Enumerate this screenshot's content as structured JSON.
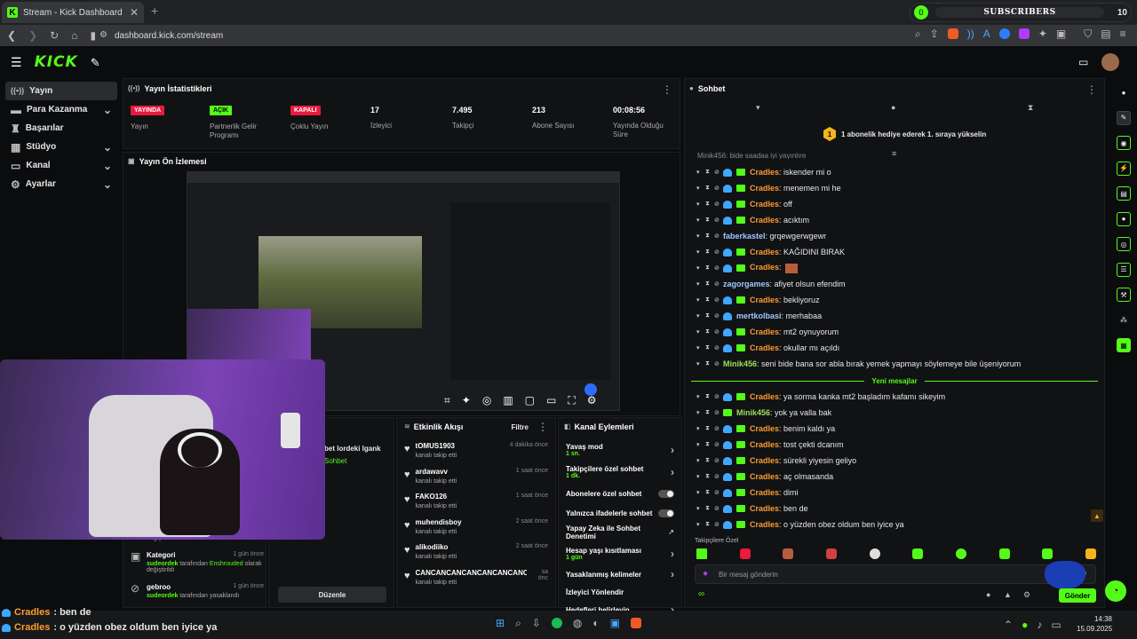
{
  "browser": {
    "tab_title": "Stream - Kick Dashboard",
    "url": "dashboard.kick.com/stream",
    "new_tab": "+"
  },
  "subs_widget": {
    "current": "0",
    "label": "SUBSCRIBERS",
    "goal": "10"
  },
  "header": {
    "logo": "KICK"
  },
  "sidebar": {
    "items": [
      {
        "label": "Yayın",
        "icon": "broadcast-icon",
        "chevron": false
      },
      {
        "label": "Para Kazanma",
        "icon": "money-icon",
        "chevron": true
      },
      {
        "label": "Başarılar",
        "icon": "trophy-icon",
        "chevron": false
      },
      {
        "label": "Stüdyo",
        "icon": "studio-icon",
        "chevron": true
      },
      {
        "label": "Kanal",
        "icon": "channel-icon",
        "chevron": true
      },
      {
        "label": "Ayarlar",
        "icon": "gear-icon",
        "chevron": true
      }
    ]
  },
  "stats": {
    "title": "Yayın İstatistikleri",
    "items": [
      {
        "badge": "YAYINDA",
        "label": "Yayın",
        "color": "#e91a3d"
      },
      {
        "badge": "AÇIK",
        "label": "Partnerlik Gelir Programı",
        "color": "#53fc18"
      },
      {
        "badge": "KAPALI",
        "label": "Çoklu Yayın",
        "color": "#e91a3d"
      },
      {
        "value": "17",
        "label": "İzleyici"
      },
      {
        "value": "7.495",
        "label": "Takipçi"
      },
      {
        "value": "213",
        "label": "Abone Sayısı"
      },
      {
        "value": "00:08:56",
        "label": "Yayında Olduğu Süre"
      }
    ]
  },
  "preview": {
    "title": "Yayın Ön İzlemesi"
  },
  "log": {
    "items": [
      {
        "title": "Kategori",
        "time": "1 gün önce",
        "user": "sudeordek",
        "text": "tarafından",
        "extra": "Enshrouded",
        "tail": "olarak değiştirildi"
      },
      {
        "title": "gebroo",
        "time": "1 gün önce",
        "user": "sudeordek",
        "text": "tarafından yasaklandı",
        "extra": "",
        "tail": ""
      }
    ],
    "partial_top": "değiştirildi"
  },
  "ghost": {
    "line1": "bet lordeki lgank",
    "line2": "Sohbet",
    "button": "Düzenle"
  },
  "activity": {
    "title": "Etkinlik Akışı",
    "filter": "Filtre",
    "items": [
      {
        "name": "tOMUS1903",
        "sub": "kanalı takip etti",
        "time": "4 dakika önce"
      },
      {
        "name": "ardawavv",
        "sub": "kanalı takip etti",
        "time": "1 saat önce"
      },
      {
        "name": "FAKO126",
        "sub": "kanalı takip etti",
        "time": "1 saat önce"
      },
      {
        "name": "muhendisboy",
        "sub": "kanalı takip etti",
        "time": "2 saat önce"
      },
      {
        "name": "alikodiiko",
        "sub": "kanalı takip etti",
        "time": "2 saat önce"
      },
      {
        "name": "CANCANCANCANCANCANCANCANN",
        "sub": "kanalı takip etti",
        "time": "sa önc"
      }
    ]
  },
  "actions": {
    "title": "Kanal Eylemleri",
    "items": [
      {
        "label": "Yavaş mod",
        "sub": "1 sn.",
        "control": "chevron"
      },
      {
        "label": "Takipçilere özel sohbet",
        "sub": "1 dk.",
        "control": "chevron"
      },
      {
        "label": "Abonelere özel sohbet",
        "sub": "",
        "control": "toggle"
      },
      {
        "label": "Yalnızca ifadelerle sohbet",
        "sub": "",
        "control": "toggle"
      },
      {
        "label": "Yapay Zeka ile Sohbet Denetimi",
        "sub": "",
        "control": "external"
      },
      {
        "label": "Hesap yaşı kısıtlaması",
        "sub": "1 gün",
        "control": "chevron"
      },
      {
        "label": "Yasaklanmış kelimeler",
        "sub": "",
        "control": "chevron"
      },
      {
        "label": "İzleyici Yönlendir",
        "sub": "",
        "control": ""
      },
      {
        "label": "Hedefleri belirleyin",
        "sub": "",
        "control": "chevron"
      }
    ]
  },
  "chat": {
    "title": "Sohbet",
    "pinned": "1 abonelik hediye ederek 1. sıraya yükselin",
    "pinned_rank": "1",
    "partial_top": "Minik456: bide saadaa iyi yayınlıre",
    "messages": [
      {
        "user": "Cradles",
        "text": "iskender mi o",
        "color": "#ff9b2f",
        "badges": true
      },
      {
        "user": "Cradles",
        "text": "menemen mi he",
        "color": "#ff9b2f",
        "badges": true
      },
      {
        "user": "Cradles",
        "text": "off",
        "color": "#ff9b2f",
        "badges": true
      },
      {
        "user": "Cradles",
        "text": "acıktım",
        "color": "#ff9b2f",
        "badges": true
      },
      {
        "user": "faberkastel",
        "text": "grqewgerwgewr",
        "color": "#9ec9ff",
        "badges": false
      },
      {
        "user": "Cradles",
        "text": "KAĞIDINI BIRAK",
        "color": "#ff9b2f",
        "badges": true
      },
      {
        "user": "Cradles",
        "text": "",
        "color": "#ff9b2f",
        "badges": true,
        "emote": true
      },
      {
        "user": "zagorgames",
        "text": "afiyet olsun efendim",
        "color": "#9ec9ff",
        "badges": false
      },
      {
        "user": "Cradles",
        "text": "bekliyoruz",
        "color": "#ff9b2f",
        "badges": true
      },
      {
        "user": "mertkolbasi",
        "text": "merhabaa",
        "color": "#9ec9ff",
        "badges": "duck"
      },
      {
        "user": "Cradles",
        "text": "mt2 oynuyorum",
        "color": "#ff9b2f",
        "badges": true
      },
      {
        "user": "Cradles",
        "text": "okullar mı açıldı",
        "color": "#ff9b2f",
        "badges": true
      },
      {
        "user": "Minik456",
        "text": "seni bide bana sor abla bırak yemek yapmayı söylemeye bile üşeniyorum",
        "color": "#9de05a",
        "badges": false
      }
    ],
    "new_messages_label": "Yeni mesajlar",
    "messages_after": [
      {
        "user": "Cradles",
        "text": "ya sorma kanka mt2 başladım kafamı sikeyim",
        "color": "#ff9b2f",
        "badges": true
      },
      {
        "user": "Minik456",
        "text": "yok ya valla bak",
        "color": "#9de05a",
        "badges": "gift"
      },
      {
        "user": "Cradles",
        "text": "benim kaldı ya",
        "color": "#ff9b2f",
        "badges": true
      },
      {
        "user": "Cradles",
        "text": "tost çekti dcanım",
        "color": "#ff9b2f",
        "badges": true
      },
      {
        "user": "Cradles",
        "text": "sürekli yiyesin geliyo",
        "color": "#ff9b2f",
        "badges": true
      },
      {
        "user": "Cradles",
        "text": "aç olmasanda",
        "color": "#ff9b2f",
        "badges": true
      },
      {
        "user": "Cradles",
        "text": "dimi",
        "color": "#ff9b2f",
        "badges": true
      },
      {
        "user": "Cradles",
        "text": "ben de",
        "color": "#ff9b2f",
        "badges": true
      },
      {
        "user": "Cradles",
        "text": "o yüzden obez oldum ben iyice ya",
        "color": "#ff9b2f",
        "badges": true
      }
    ],
    "followers_only": "Takipçilere Özel",
    "input_placeholder": "Bir mesaj gönderin",
    "send": "Gönder"
  },
  "overlay": {
    "lines": [
      {
        "user": "Cradles",
        "text": ": ben de"
      },
      {
        "user": "Cradles",
        "text": ": o yüzden obez oldum ben iyice ya"
      }
    ]
  },
  "taskbar": {
    "time": "14:38",
    "date": "15.09.2025"
  },
  "colors": {
    "accent": "#53fc18",
    "live": "#e91a3d"
  }
}
